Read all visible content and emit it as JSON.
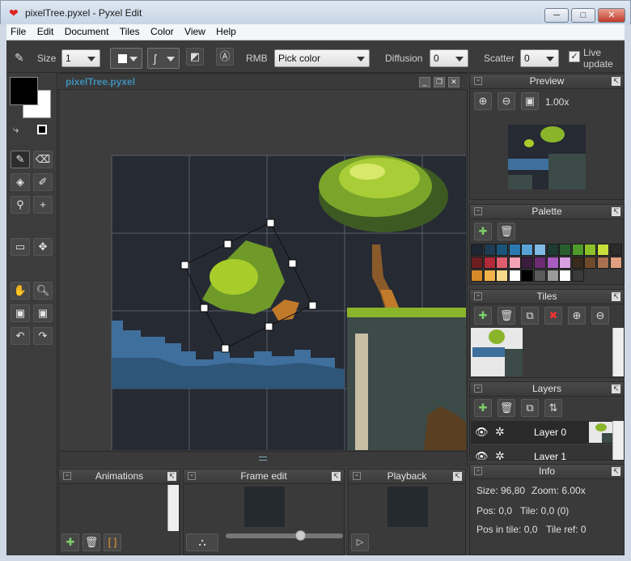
{
  "window": {
    "title": "pixelTree.pyxel - Pyxel Edit"
  },
  "menu": [
    "File",
    "Edit",
    "Document",
    "Tiles",
    "Color",
    "View",
    "Help"
  ],
  "toolbar": {
    "size_label": "Size",
    "size_value": "1",
    "rmb_label": "RMB",
    "rmb_value": "Pick color",
    "diffusion_label": "Diffusion",
    "diffusion_value": "0",
    "scatter_label": "Scatter",
    "scatter_value": "0",
    "live_update_line1": "Live",
    "live_update_line2": "update"
  },
  "canvas": {
    "title": "pixelTree.pyxel"
  },
  "preview": {
    "title": "Preview",
    "zoom": "1.00x"
  },
  "palette": {
    "title": "Palette",
    "colors": [
      "#1e2633",
      "#1d3b52",
      "#1a5478",
      "#2a7ab2",
      "#5aa3d7",
      "#7fbbe5",
      "#1d3a33",
      "#2b5e2e",
      "#4f9a2a",
      "#8cc12a",
      "#c7df3a",
      "#2a2a2a",
      "#6b1d22",
      "#b2293a",
      "#de5d6e",
      "#f3a3b5",
      "#3a1d3d",
      "#6e2a73",
      "#a85cc0",
      "#d8a0e0",
      "#3a2a1d",
      "#6e4a2a",
      "#a87050",
      "#e0a080",
      "#d68a2a",
      "#f2b24a",
      "#f8d98a",
      "#ffffff",
      "#000000",
      "#5a5a5a",
      "#9a9a9a",
      "#ffffff",
      "#3a3a3a"
    ]
  },
  "tiles": {
    "title": "Tiles"
  },
  "layers": {
    "title": "Layers",
    "items": [
      {
        "name": "Layer 0"
      },
      {
        "name": "Layer 1"
      }
    ]
  },
  "info": {
    "title": "Info",
    "size": "Size: 96,80",
    "zoom": "Zoom: 6.00x",
    "pos": "Pos: 0,0",
    "tile": "Tile: 0,0 (0)",
    "pos_in_tile": "Pos in tile: 0,0",
    "tile_ref": "Tile ref: 0"
  },
  "animations": {
    "title": "Animations"
  },
  "frame_edit": {
    "title": "Frame edit"
  },
  "playback": {
    "title": "Playback"
  }
}
